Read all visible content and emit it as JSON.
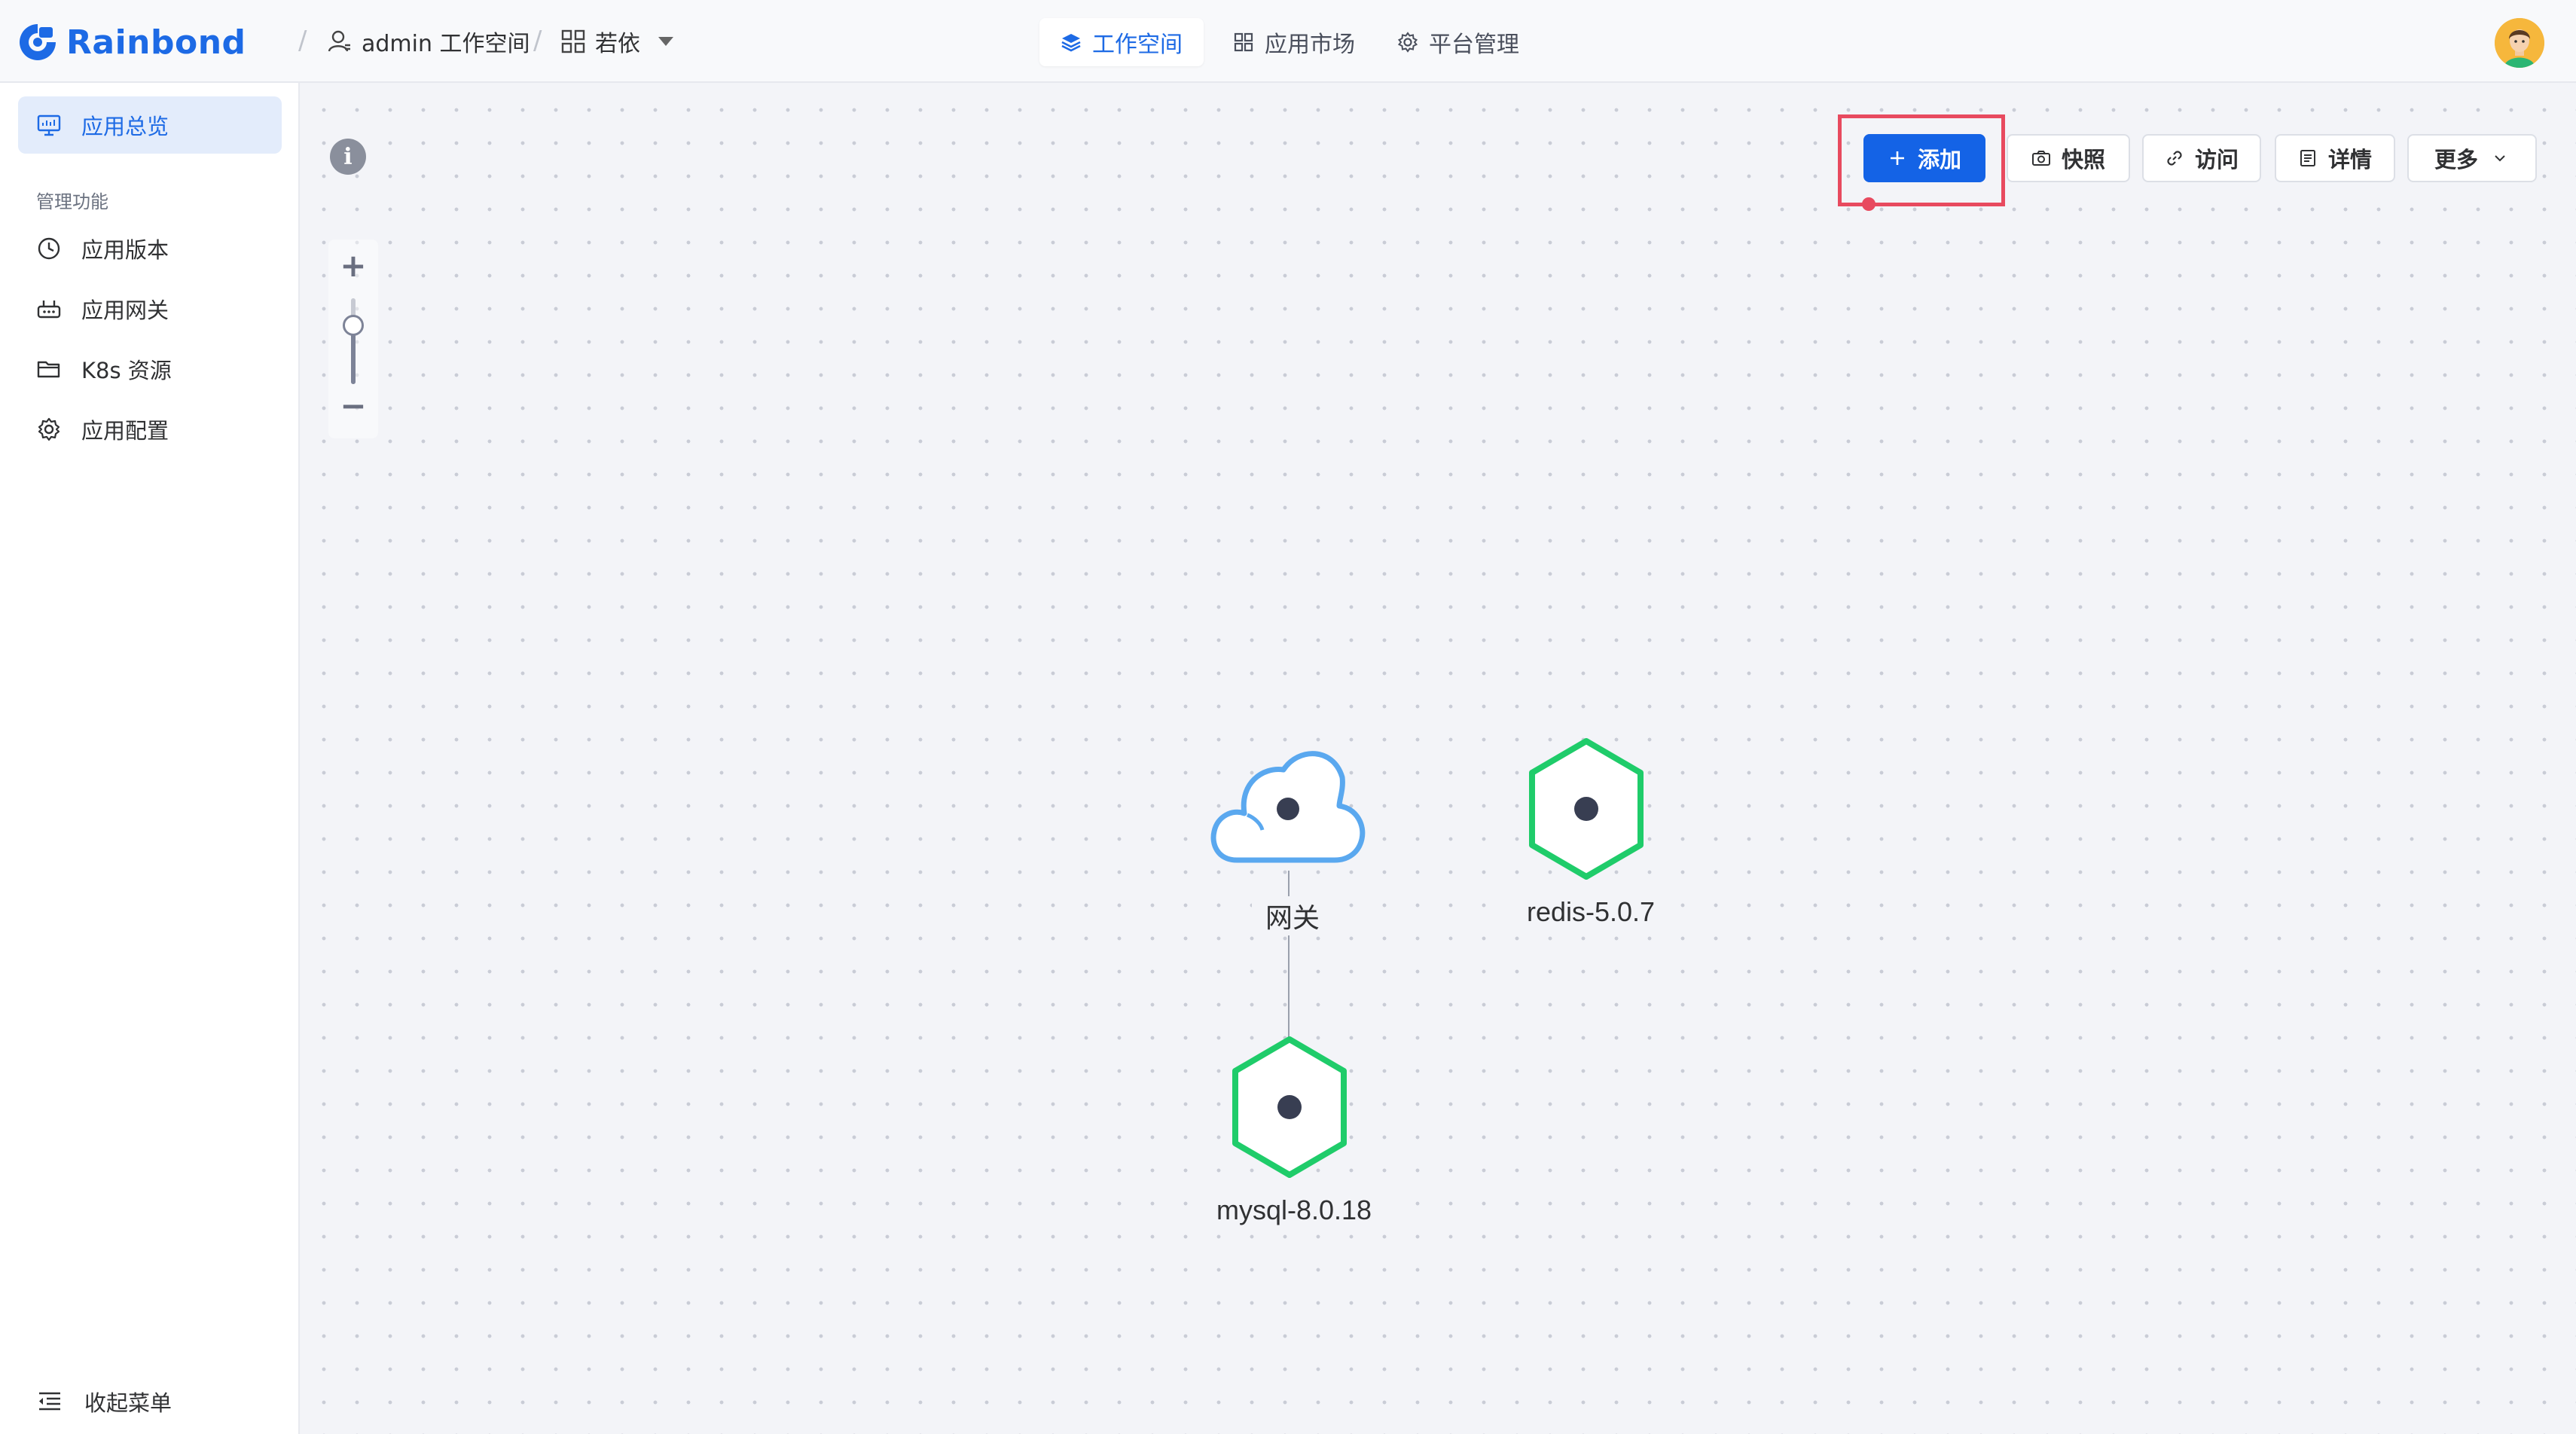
{
  "app": {
    "logo_text": "Rainbond",
    "accent": "#1d6ae5"
  },
  "breadcrumb": {
    "workspace": "admin 工作空间",
    "app": "若依",
    "workspace_icon": "user-icon",
    "app_icon": "grid-icon"
  },
  "nav": {
    "workspace": "工作空间",
    "market": "应用市场",
    "platform": "平台管理"
  },
  "sidebar": {
    "overview": "应用总览",
    "group": "管理功能",
    "items": [
      {
        "label": "应用版本",
        "icon": "clock-icon"
      },
      {
        "label": "应用网关",
        "icon": "gateway-icon"
      },
      {
        "label": "K8s 资源",
        "icon": "folder-icon"
      },
      {
        "label": "应用配置",
        "icon": "gear-icon"
      }
    ],
    "collapse": "收起菜单"
  },
  "toolbar": {
    "add": "添加",
    "snapshot": "快照",
    "visit": "访问",
    "details": "详情",
    "more": "更多"
  },
  "topology": {
    "nodes": [
      {
        "label": "网关",
        "type": "gateway",
        "color": "#5aa8ef"
      },
      {
        "label": "redis-5.0.7",
        "type": "component",
        "color": "#1fcc6a"
      },
      {
        "label": "mysql-8.0.18",
        "type": "component",
        "color": "#1fcc6a"
      }
    ],
    "edges": [
      {
        "from": "网关",
        "to": "mysql-8.0.18"
      }
    ]
  },
  "colors": {
    "highlight": "#e84a5f",
    "primary_button": "#1463e6",
    "running": "#1fcc6a"
  }
}
